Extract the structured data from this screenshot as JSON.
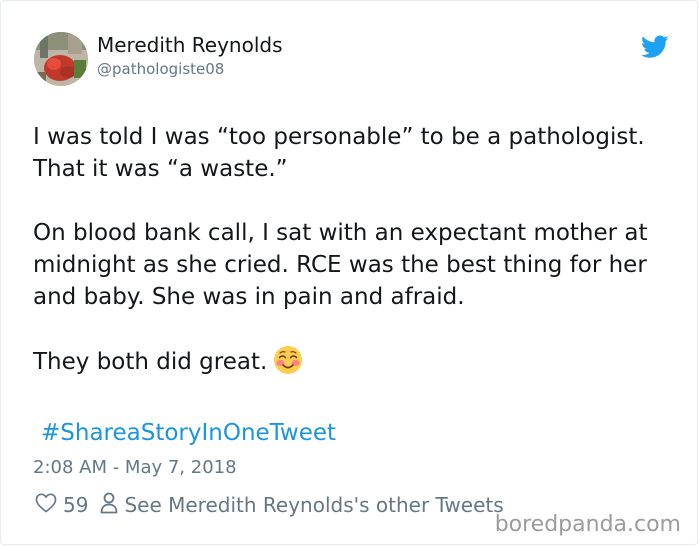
{
  "tweet": {
    "display_name": "Meredith Reynolds",
    "handle": "@pathologiste08",
    "paragraphs": [
      "I was told I was “too personable” to be a pathologist. That it was “a waste.”",
      "On blood bank call, I sat with an expectant mother at midnight as she cried. RCE was the best thing for her and baby. She was in pain and afraid.",
      "They both did great."
    ],
    "hashtag": "#ShareaStoryInOneTweet",
    "timestamp": "2:08 AM - May 7, 2018",
    "like_count": "59",
    "profile_link_label": "See Meredith Reynolds's other Tweets"
  },
  "watermark": "boredpanda.com",
  "icons": {
    "brand": "twitter-bird-icon",
    "like": "heart-icon",
    "profile": "person-icon",
    "emoji": "smiling-face-with-blush-emoji"
  },
  "colors": {
    "twitter_blue": "#1da1f2",
    "link_blue": "#1b95e0",
    "text": "#14171a",
    "muted": "#657786"
  }
}
